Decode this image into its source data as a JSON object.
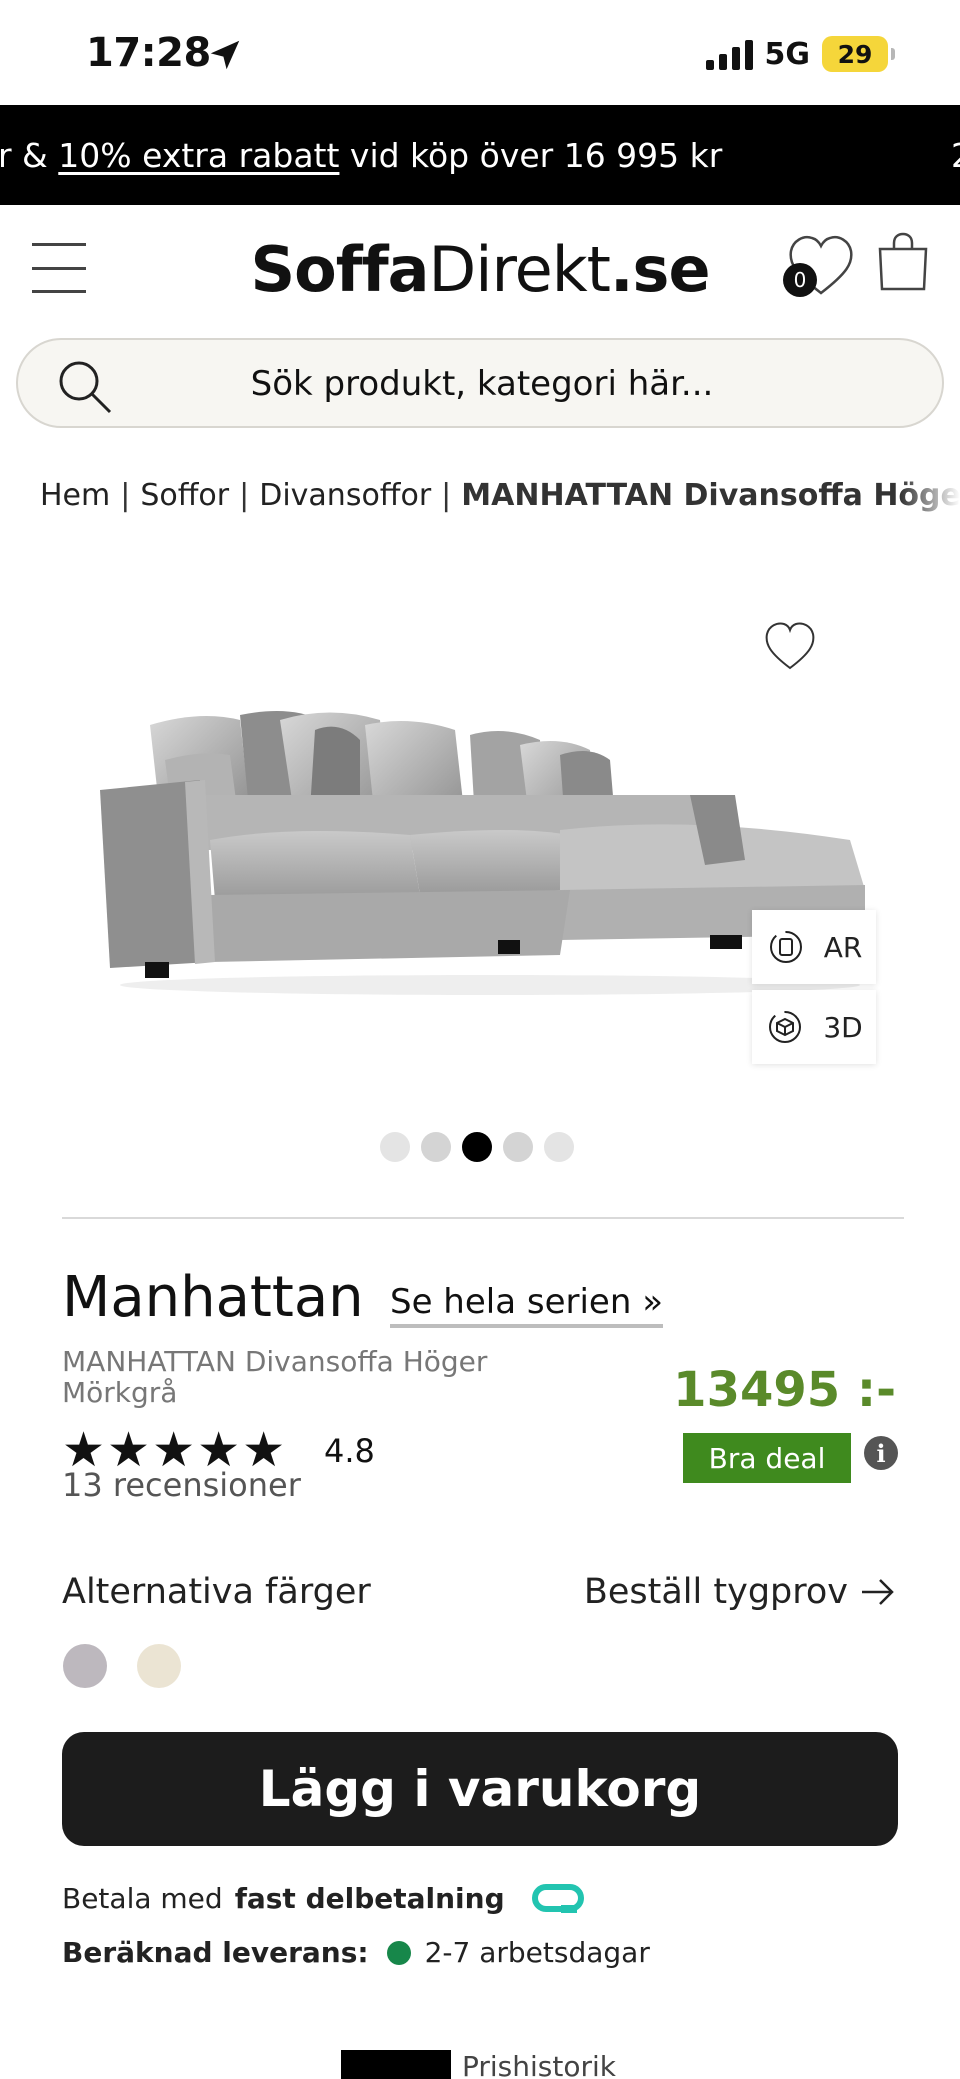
{
  "status_bar": {
    "time": "17:28",
    "network": "5G",
    "battery": "29"
  },
  "promo": {
    "prefix": "r & ",
    "link": "10% extra rabatt",
    "suffix": " vid köp över 16 995 kr",
    "right_fragment": "2"
  },
  "header": {
    "logo_bold": "Soffa",
    "logo_light": "Direkt",
    "logo_tld": ".se",
    "wishlist_count": "0"
  },
  "search": {
    "placeholder": "Sök produkt, kategori här..."
  },
  "breadcrumb": {
    "items": [
      "Hem",
      "Soffor",
      "Divansoffor"
    ],
    "current": "MANHATTAN Divansoffa Höger"
  },
  "gallery": {
    "ar_label": "AR",
    "threed_label": "3D",
    "slide_count": 5,
    "active_slide": 3
  },
  "product": {
    "name": "Manhattan",
    "series_link": "Se hela serien »",
    "subtitle": "MANHATTAN Divansoffa Höger Mörkgrå",
    "price": "13495 :-",
    "deal_badge": "Bra deal",
    "stars": "★★★★★",
    "rating": "4.8",
    "reviews": "13 recensioner",
    "alt_colors_label": "Alternativa färger",
    "fabric_sample_label": "Beställ tygprov",
    "swatch_colors": [
      "#bdb8be",
      "#ebe4d3"
    ],
    "add_to_cart": "Lägg i varukorg",
    "payment_prefix": "Betala med",
    "payment_bold": "fast delbetalning",
    "delivery_label": "Beräknad leverans:",
    "delivery_value": "2-7 arbetsdagar",
    "price_history": "Prishistorik"
  },
  "colors": {
    "price_green": "#5a8a2a",
    "deal_green": "#3f8a1e",
    "delivery_dot": "#17874a",
    "battery": "#f5d63a"
  }
}
